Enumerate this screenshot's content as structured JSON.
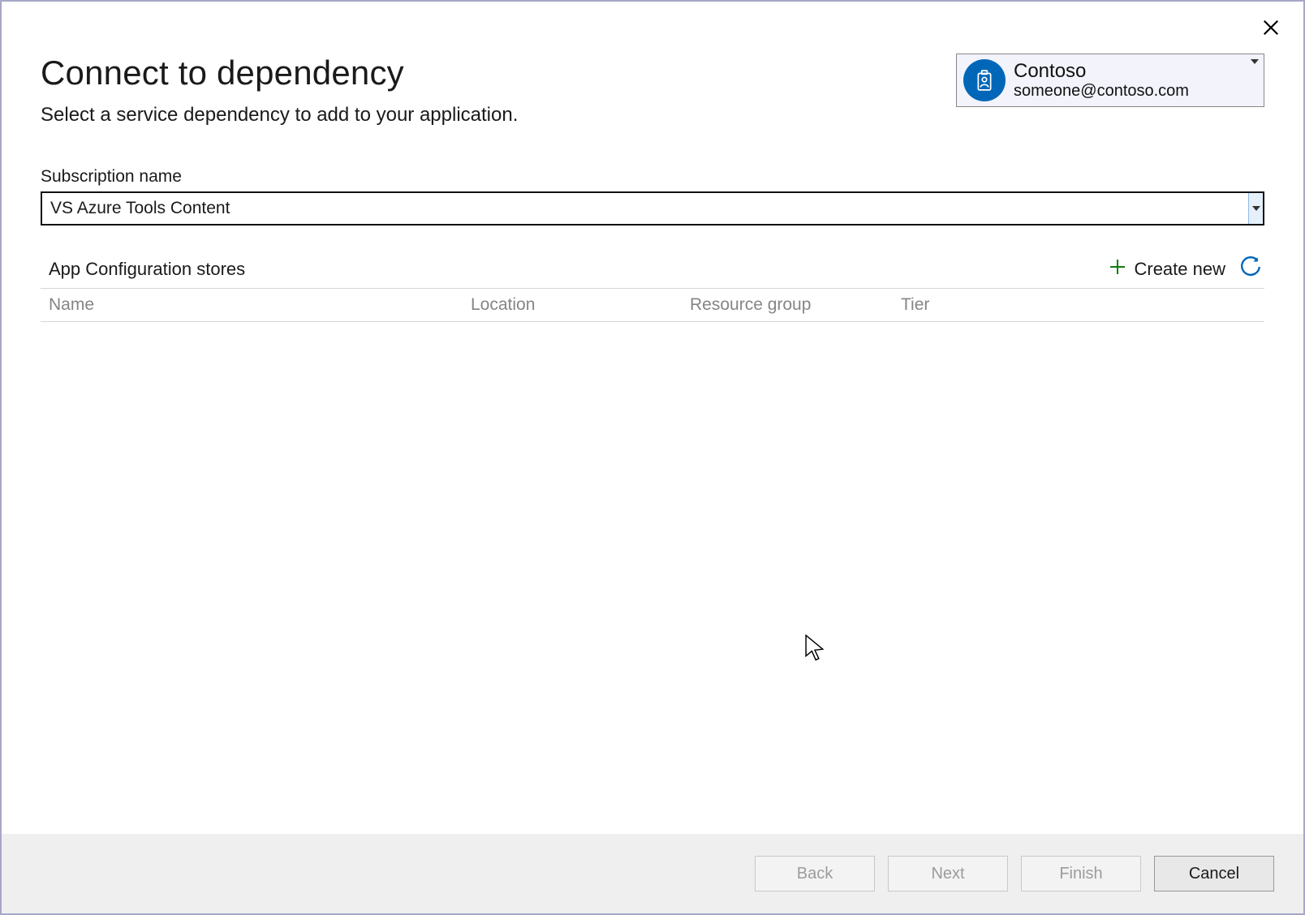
{
  "dialog": {
    "title": "Connect to dependency",
    "subtitle": "Select a service dependency to add to your application."
  },
  "account": {
    "name": "Contoso",
    "email": "someone@contoso.com"
  },
  "subscription": {
    "label": "Subscription name",
    "value": "VS Azure Tools Content"
  },
  "section": {
    "title": "App Configuration stores",
    "create_new": "Create new"
  },
  "table": {
    "columns": {
      "name": "Name",
      "location": "Location",
      "resource_group": "Resource group",
      "tier": "Tier"
    }
  },
  "footer": {
    "back": "Back",
    "next": "Next",
    "finish": "Finish",
    "cancel": "Cancel"
  }
}
